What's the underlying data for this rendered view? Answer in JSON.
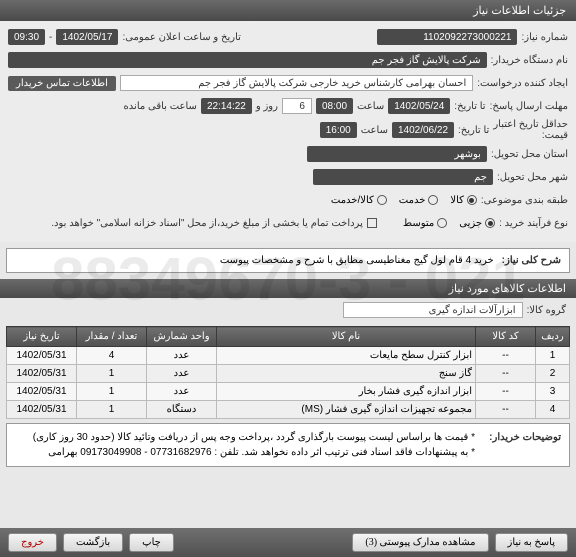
{
  "watermark": "021 - 88349670-3",
  "header": {
    "title": "جزئیات اطلاعات نیاز"
  },
  "form": {
    "req_no_label": "شماره نیاز:",
    "req_no": "1102092273000221",
    "announce_label": "تاریخ و ساعت اعلان عمومی:",
    "announce_date": "1402/05/17",
    "announce_time": "09:30",
    "sep": " - ",
    "buyer_org_label": "نام دستگاه خریدار:",
    "buyer_org": "شرکت پالایش گاز فجر جم",
    "creator_label": "ایجاد کننده درخواست:",
    "creator": "احسان بهرامی کارشناس خرید خارجی شرکت پالایش گاز فجر جم",
    "contact_btn": "اطلاعات تماس خریدار",
    "deadline_label": "مهلت ارسال پاسخ:",
    "deadline_until": "تا تاریخ:",
    "deadline_date": "1402/05/24",
    "time_label": "ساعت",
    "deadline_time": "08:00",
    "days_label": "روز و",
    "days_val": "6",
    "remaining_time": "22:14:22",
    "remaining_label": "ساعت باقی مانده",
    "validity_label": "حداقل تاریخ اعتبار",
    "validity_label2": "قیمت:",
    "validity_until": "تا تاریخ:",
    "validity_date": "1402/06/22",
    "validity_time": "16:00",
    "province_label": "استان محل تحویل:",
    "province": "بوشهر",
    "city_label": "شهر محل تحویل:",
    "city": "جم",
    "category_label": "طبقه بندی موضوعی:",
    "cat_goods": "کالا",
    "cat_service": "خدمت",
    "cat_both": "کالا/خدمت",
    "process_label": "نوع فرآیند خرید :",
    "proc_low": "جزیی",
    "proc_mid": "متوسط",
    "partial_pay": "پرداخت تمام یا بخشی از مبلغ خرید،از محل \"اسناد خزانه اسلامی\" خواهد بود."
  },
  "need_summary": {
    "label": "شرح کلی نیاز:",
    "text": "خرید 4 قام لول گیج مغناطیسی مطابق با شرح و مشخصات پیوست"
  },
  "items_header": "اطلاعات کالاهای مورد نیاز",
  "group": {
    "label": "گروه کالا:",
    "value": "ابزارآلات اندازه گیری"
  },
  "table": {
    "headers": {
      "row": "ردیف",
      "code": "کد کالا",
      "name": "نام کالا",
      "unit": "واحد شمارش",
      "qty": "تعداد / مقدار",
      "date": "تاریخ نیاز"
    },
    "rows": [
      {
        "row": "1",
        "code": "--",
        "name": "ابزار کنترل سطح مایعات",
        "unit": "عدد",
        "qty": "4",
        "date": "1402/05/31"
      },
      {
        "row": "2",
        "code": "--",
        "name": "گاز سنج",
        "unit": "عدد",
        "qty": "1",
        "date": "1402/05/31"
      },
      {
        "row": "3",
        "code": "--",
        "name": "ابزار اندازه گیری فشار بخار",
        "unit": "عدد",
        "qty": "1",
        "date": "1402/05/31"
      },
      {
        "row": "4",
        "code": "--",
        "name": "مجموعه تجهیزات اندازه گیری فشار (MS)",
        "unit": "دستگاه",
        "qty": "1",
        "date": "1402/05/31"
      }
    ]
  },
  "buyer_notes": {
    "label": "توضیحات خریدار:",
    "text": "* قیمت ها براساس لیست پیوست بارگذاری گردد ،پرداخت وجه پس از دریافت وتائید کالا (حدود 30 روز کاری)\n* به پیشنهادات فاقد اسناد فنی ترتیب اثر داده نخواهد شد. تلفن : 07731682976 - 09173049908 بهرامی"
  },
  "footer": {
    "respond": "پاسخ به نیاز",
    "attachments": "مشاهده مدارک پیوستی (3)",
    "print": "چاپ",
    "back": "بازگشت",
    "exit": "خروج"
  }
}
